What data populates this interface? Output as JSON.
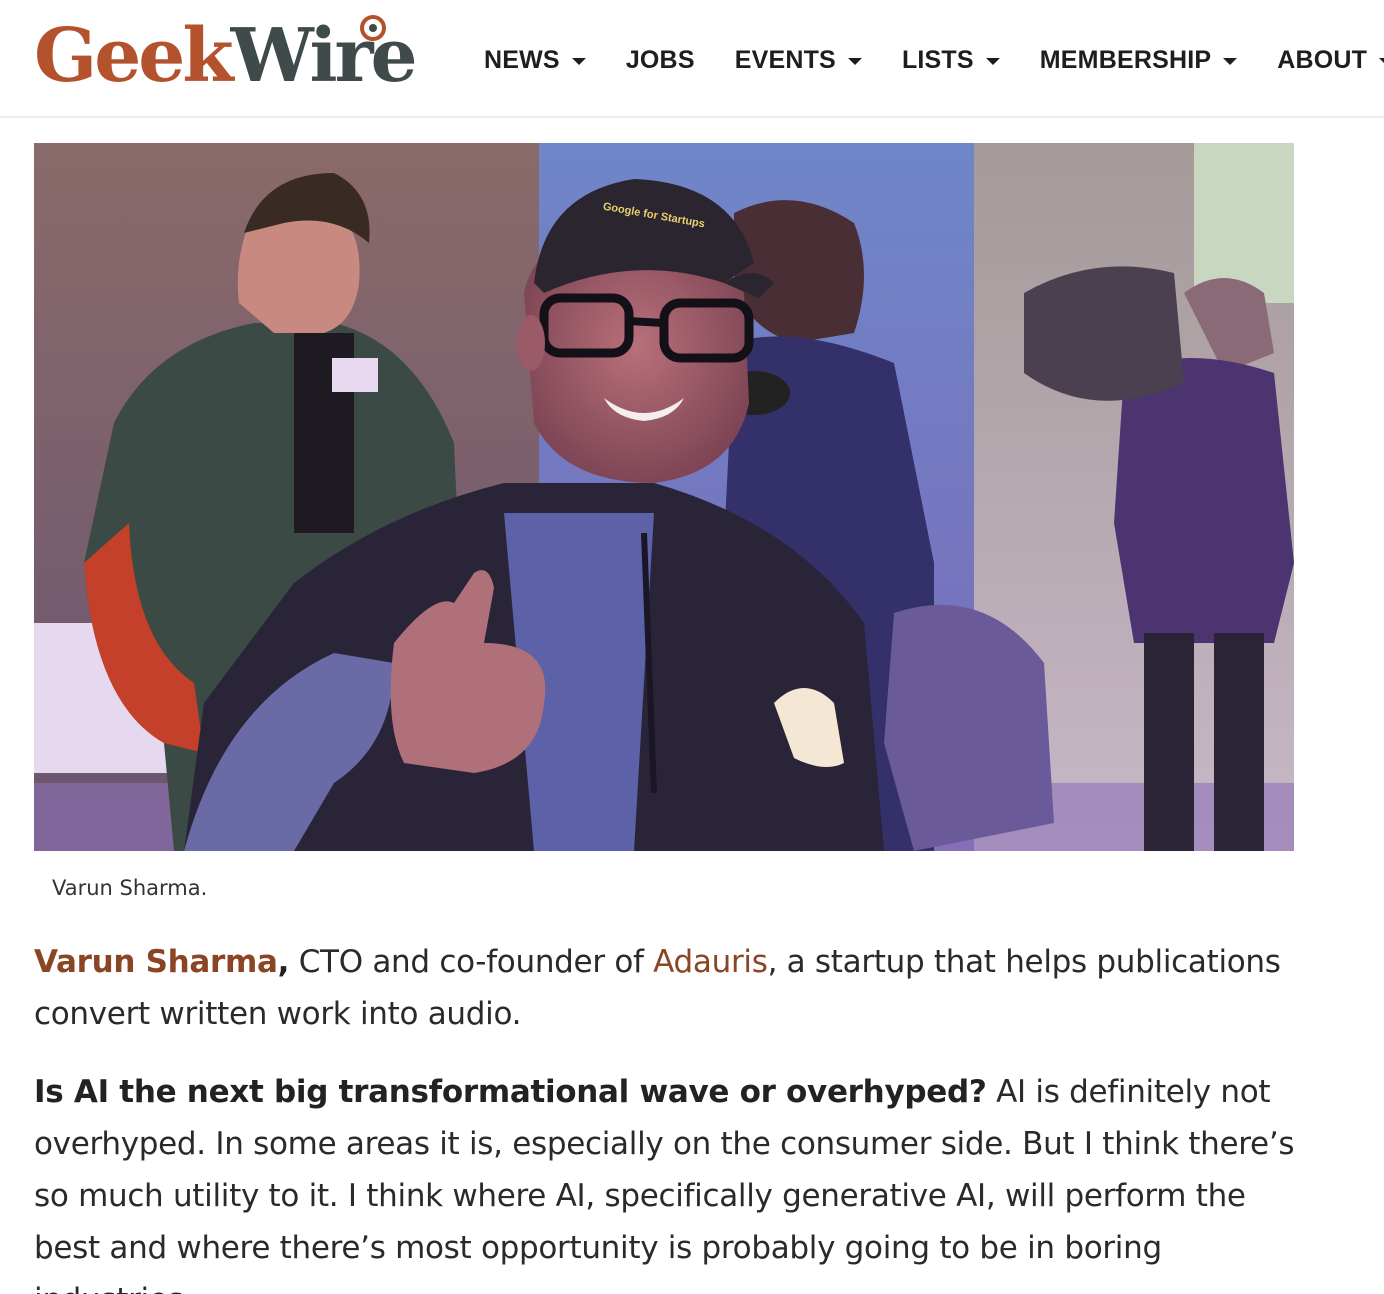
{
  "brand": {
    "part1": "Geek",
    "part2": "Wire"
  },
  "nav": {
    "items": [
      {
        "label": "NEWS",
        "dropdown": true
      },
      {
        "label": "JOBS",
        "dropdown": false
      },
      {
        "label": "EVENTS",
        "dropdown": true
      },
      {
        "label": "LISTS",
        "dropdown": true
      },
      {
        "label": "MEMBERSHIP",
        "dropdown": true
      },
      {
        "label": "ABOUT",
        "dropdown": true
      }
    ]
  },
  "photo": {
    "caption": "Varun Sharma.",
    "cap_text": "Google for Startups"
  },
  "article": {
    "intro": {
      "name": "Varun Sharma",
      "comma": ",",
      "text_before": " CTO and co-founder of ",
      "company": "Adauris",
      "text_after": ", a startup that helps publications convert written work into audio."
    },
    "qa": {
      "question": "Is AI the next big transformational wave or overhyped?",
      "answer": " AI is definitely not overhyped. In some areas it is, especially on the consumer side. But I think there’s so much utility to it. I think where AI, specifically generative AI, will perform the best and where there’s most opportunity is probably going to be in boring industries."
    }
  },
  "colors": {
    "brand_orange": "#b3522c",
    "brand_dark": "#3f4a4a",
    "link": "#8a4524"
  }
}
